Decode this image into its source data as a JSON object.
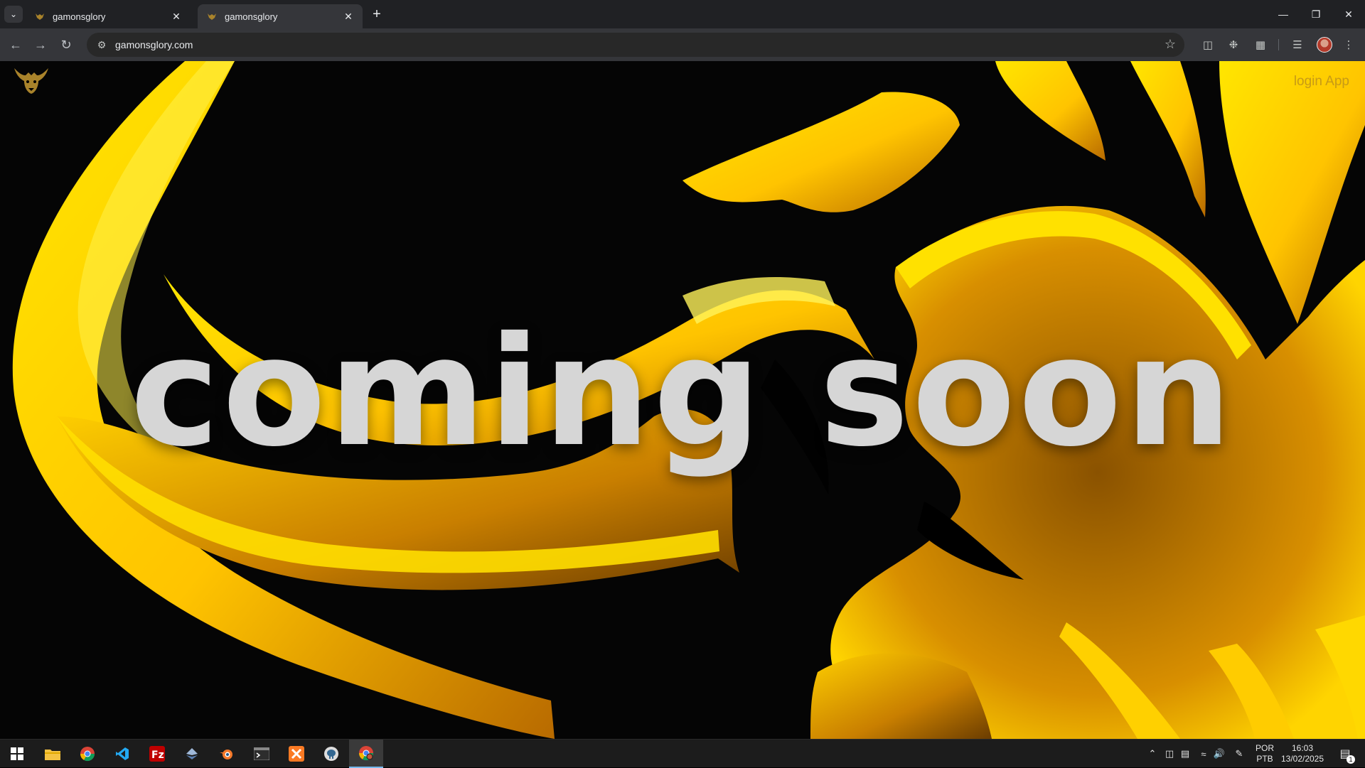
{
  "browser": {
    "tabs": [
      {
        "title": "gamonsglory",
        "active": false
      },
      {
        "title": "gamonsglory",
        "active": true
      }
    ],
    "url": "gamonsglory.com",
    "icons": [
      "tab-list-icon",
      "close-icon",
      "new-tab-icon",
      "minimize-icon",
      "restore-icon",
      "close-window-icon",
      "back-icon",
      "forward-icon",
      "reload-icon",
      "site-info-icon",
      "bookmark-star-icon",
      "reading-mode-icon",
      "extension-icon",
      "extensions-puzzle-icon",
      "media-queue-icon",
      "profile-avatar",
      "menu-icon"
    ]
  },
  "page": {
    "login_label": "login App",
    "hero_text": "coming soon",
    "colors": {
      "background": "#050505",
      "gold": "#ffd400",
      "gold_dark": "#c07a00",
      "hero_text": "#d6d6d6",
      "login": "#c79a16"
    }
  },
  "taskbar": {
    "apps": [
      "windows-start",
      "file-explorer",
      "chrome",
      "vscode",
      "filezilla",
      "dev-tool",
      "blender",
      "terminal",
      "xampp",
      "pgadmin",
      "chrome-active"
    ],
    "language_line1": "POR",
    "language_line2": "PTB",
    "time": "16:03",
    "date": "13/02/2025",
    "notification_count": "1"
  }
}
